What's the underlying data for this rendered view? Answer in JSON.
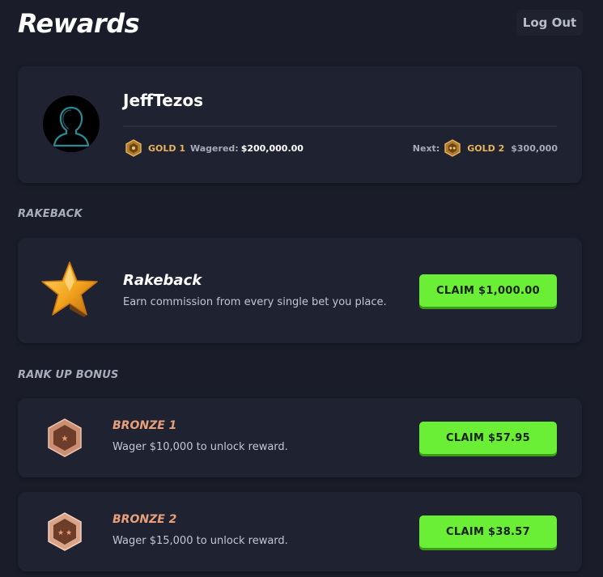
{
  "header": {
    "title": "Rewards",
    "logout_label": "Log Out"
  },
  "profile": {
    "username": "JeffTezos",
    "current_rank": "GOLD 1",
    "wagered_label": "Wagered:",
    "wagered_value": "$200,000.00",
    "next_label": "Next:",
    "next_rank": "GOLD 2",
    "next_threshold": "$300,000"
  },
  "rakeback_section": {
    "label": "RAKEBACK",
    "title": "Rakeback",
    "description": "Earn commission from every single bet you place.",
    "claim_label": "CLAIM $1,000.00"
  },
  "rank_up_section": {
    "label": "RANK UP BONUS",
    "bonuses": [
      {
        "rank": "BRONZE 1",
        "description": "Wager $10,000 to unlock reward.",
        "claim_label": "CLAIM $57.95",
        "stars": 1
      },
      {
        "rank": "BRONZE 2",
        "description": "Wager $15,000 to unlock reward.",
        "claim_label": "CLAIM $38.57",
        "stars": 2
      }
    ]
  },
  "colors": {
    "background": "#1a1d29",
    "card": "#1f2230",
    "claim_green": "#6bef36",
    "gold": "#e8b45a",
    "bronze": "#e8a07a"
  }
}
